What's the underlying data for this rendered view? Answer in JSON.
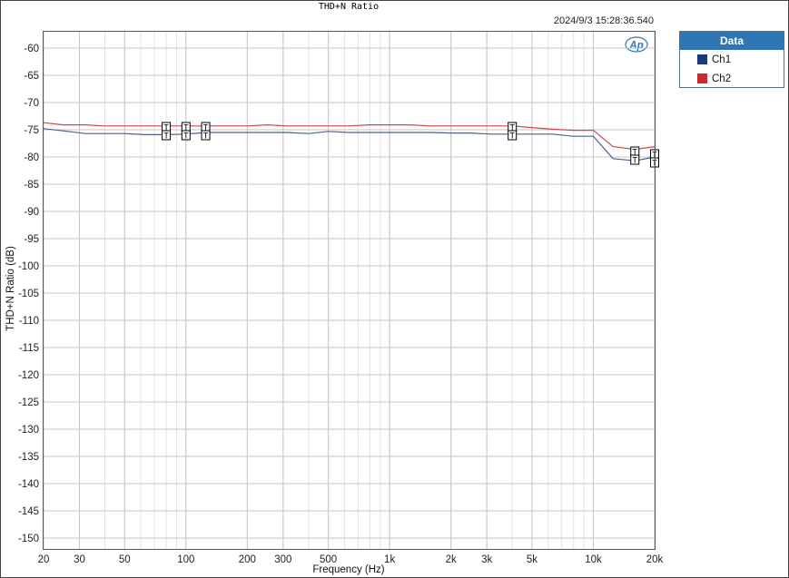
{
  "window": {
    "title": "THD+N Ratio",
    "timestamp": "2024/9/3 15:28:36.540",
    "logo": "Ap"
  },
  "legend": {
    "header": "Data",
    "items": [
      {
        "label": "Ch1",
        "color": "#1b3a7a"
      },
      {
        "label": "Ch2",
        "color": "#cc2a2a"
      }
    ]
  },
  "chart_data": {
    "type": "line",
    "title": "THD+N Ratio",
    "xlabel": "Frequency (Hz)",
    "ylabel": "THD+N Ratio (dB)",
    "xscale": "log",
    "xlim": [
      20,
      20000
    ],
    "ylim": [
      -152,
      -57
    ],
    "x_ticks": [
      {
        "value": 20,
        "label": "20"
      },
      {
        "value": 30,
        "label": "30"
      },
      {
        "value": 50,
        "label": "50"
      },
      {
        "value": 100,
        "label": "100"
      },
      {
        "value": 200,
        "label": "200"
      },
      {
        "value": 300,
        "label": "300"
      },
      {
        "value": 500,
        "label": "500"
      },
      {
        "value": 1000,
        "label": "1k"
      },
      {
        "value": 2000,
        "label": "2k"
      },
      {
        "value": 3000,
        "label": "3k"
      },
      {
        "value": 5000,
        "label": "5k"
      },
      {
        "value": 10000,
        "label": "10k"
      },
      {
        "value": 20000,
        "label": "20k"
      }
    ],
    "y_ticks": [
      {
        "value": -60,
        "label": "-60"
      },
      {
        "value": -65,
        "label": "-65"
      },
      {
        "value": -70,
        "label": "-70"
      },
      {
        "value": -75,
        "label": "-75"
      },
      {
        "value": -80,
        "label": "-80"
      },
      {
        "value": -85,
        "label": "-85"
      },
      {
        "value": -90,
        "label": "-90"
      },
      {
        "value": -95,
        "label": "-95"
      },
      {
        "value": -100,
        "label": "-100"
      },
      {
        "value": -105,
        "label": "-105"
      },
      {
        "value": -110,
        "label": "-110"
      },
      {
        "value": -115,
        "label": "-115"
      },
      {
        "value": -120,
        "label": "-120"
      },
      {
        "value": -125,
        "label": "-125"
      },
      {
        "value": -130,
        "label": "-130"
      },
      {
        "value": -135,
        "label": "-135"
      },
      {
        "value": -140,
        "label": "-140"
      },
      {
        "value": -145,
        "label": "-145"
      },
      {
        "value": -150,
        "label": "-150"
      }
    ],
    "grid": true,
    "legend_position": "right",
    "series": [
      {
        "name": "Ch1",
        "color": "#4a6090",
        "points": [
          [
            20,
            -74.8
          ],
          [
            25,
            -75.2
          ],
          [
            32,
            -75.7
          ],
          [
            40,
            -75.7
          ],
          [
            50,
            -75.7
          ],
          [
            63,
            -75.9
          ],
          [
            80,
            -75.9
          ],
          [
            100,
            -75.8
          ],
          [
            125,
            -75.5
          ],
          [
            160,
            -75.5
          ],
          [
            200,
            -75.5
          ],
          [
            250,
            -75.5
          ],
          [
            315,
            -75.5
          ],
          [
            400,
            -75.7
          ],
          [
            500,
            -75.3
          ],
          [
            630,
            -75.5
          ],
          [
            800,
            -75.5
          ],
          [
            1000,
            -75.5
          ],
          [
            1250,
            -75.5
          ],
          [
            1600,
            -75.5
          ],
          [
            2000,
            -75.6
          ],
          [
            2500,
            -75.6
          ],
          [
            3150,
            -75.8
          ],
          [
            4000,
            -75.8
          ],
          [
            5000,
            -75.8
          ],
          [
            6300,
            -75.8
          ],
          [
            8000,
            -76.2
          ],
          [
            10000,
            -76.2
          ],
          [
            12500,
            -80.3
          ],
          [
            16000,
            -80.7
          ],
          [
            20000,
            -80.0
          ]
        ]
      },
      {
        "name": "Ch2",
        "color": "#cc4a4a",
        "points": [
          [
            20,
            -73.7
          ],
          [
            25,
            -74.1
          ],
          [
            32,
            -74.1
          ],
          [
            40,
            -74.3
          ],
          [
            50,
            -74.3
          ],
          [
            63,
            -74.3
          ],
          [
            80,
            -74.3
          ],
          [
            100,
            -74.3
          ],
          [
            125,
            -74.3
          ],
          [
            160,
            -74.3
          ],
          [
            200,
            -74.3
          ],
          [
            250,
            -74.1
          ],
          [
            315,
            -74.3
          ],
          [
            400,
            -74.3
          ],
          [
            500,
            -74.3
          ],
          [
            630,
            -74.3
          ],
          [
            800,
            -74.1
          ],
          [
            1000,
            -74.1
          ],
          [
            1250,
            -74.1
          ],
          [
            1600,
            -74.3
          ],
          [
            2000,
            -74.3
          ],
          [
            2500,
            -74.3
          ],
          [
            3150,
            -74.3
          ],
          [
            4000,
            -74.3
          ],
          [
            5000,
            -74.6
          ],
          [
            6300,
            -74.9
          ],
          [
            8000,
            -75.1
          ],
          [
            10000,
            -75.1
          ],
          [
            12500,
            -78.1
          ],
          [
            16000,
            -78.6
          ],
          [
            20000,
            -78.1
          ]
        ]
      }
    ],
    "limit_markers": [
      {
        "x": 80,
        "y": -75.0,
        "label": "T"
      },
      {
        "x": 100,
        "y": -75.0,
        "label": "T"
      },
      {
        "x": 125,
        "y": -75.0,
        "label": "T"
      },
      {
        "x": 4000,
        "y": -75.0,
        "label": "T"
      },
      {
        "x": 16000,
        "y": -79.5,
        "label": "T"
      },
      {
        "x": 20000,
        "y": -80.0,
        "label": "T"
      }
    ]
  }
}
